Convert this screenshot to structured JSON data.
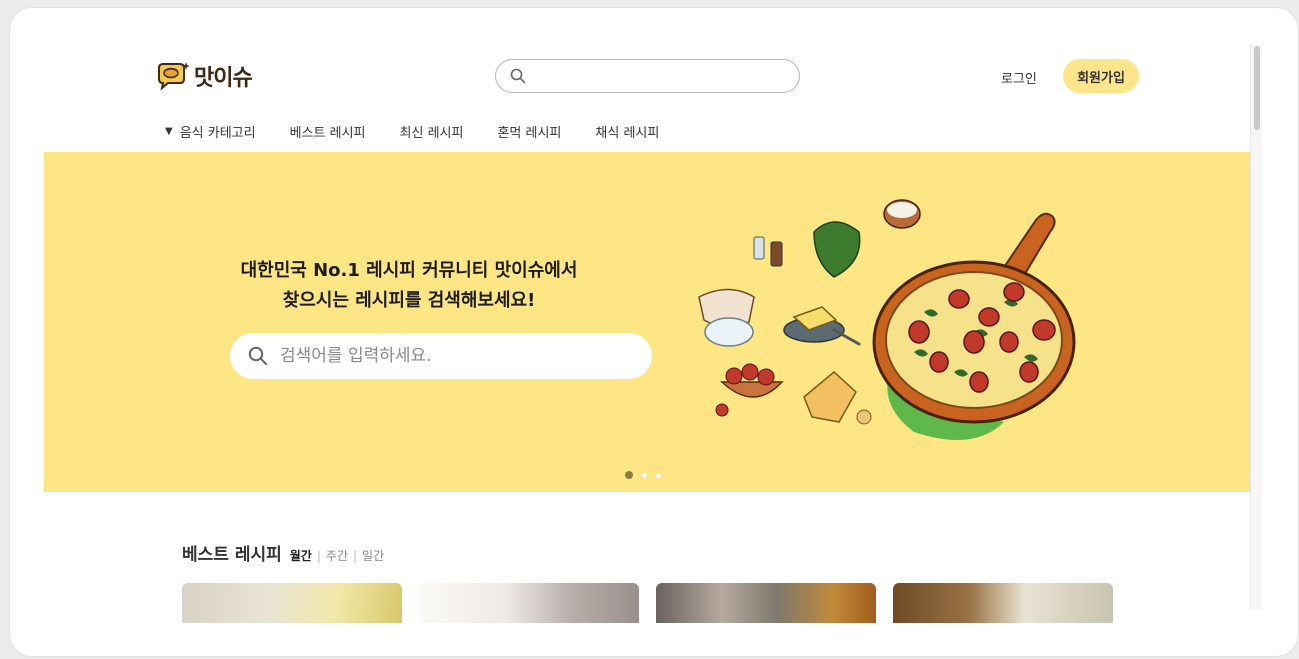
{
  "header": {
    "logo_text": "맛이슈",
    "search_placeholder": "",
    "login_label": "로그인",
    "signup_label": "회원가입"
  },
  "nav": {
    "items": [
      {
        "label": "음식 카테고리",
        "has_dropdown": true
      },
      {
        "label": "베스트 레시피"
      },
      {
        "label": "최신 레시피"
      },
      {
        "label": "혼먹 레시피"
      },
      {
        "label": "채식 레시피"
      }
    ]
  },
  "hero": {
    "title_line1": "대한민국 No.1 레시피 커뮤니티 맛이슈에서",
    "title_line2": "찾으시는 레시피를 검색해보세요!",
    "search_placeholder": "검색어를 입력하세요.",
    "background_color": "#fee685",
    "carousel_total": 3,
    "carousel_active": 1
  },
  "best_recipes": {
    "title": "베스트 레시피",
    "periods": [
      "월간",
      "주간",
      "일간"
    ],
    "active_period": "월간",
    "card_count": 4
  },
  "colors": {
    "accent": "#ffe58a",
    "hero_bg": "#fee685",
    "logo_brown": "#3b2a16"
  }
}
